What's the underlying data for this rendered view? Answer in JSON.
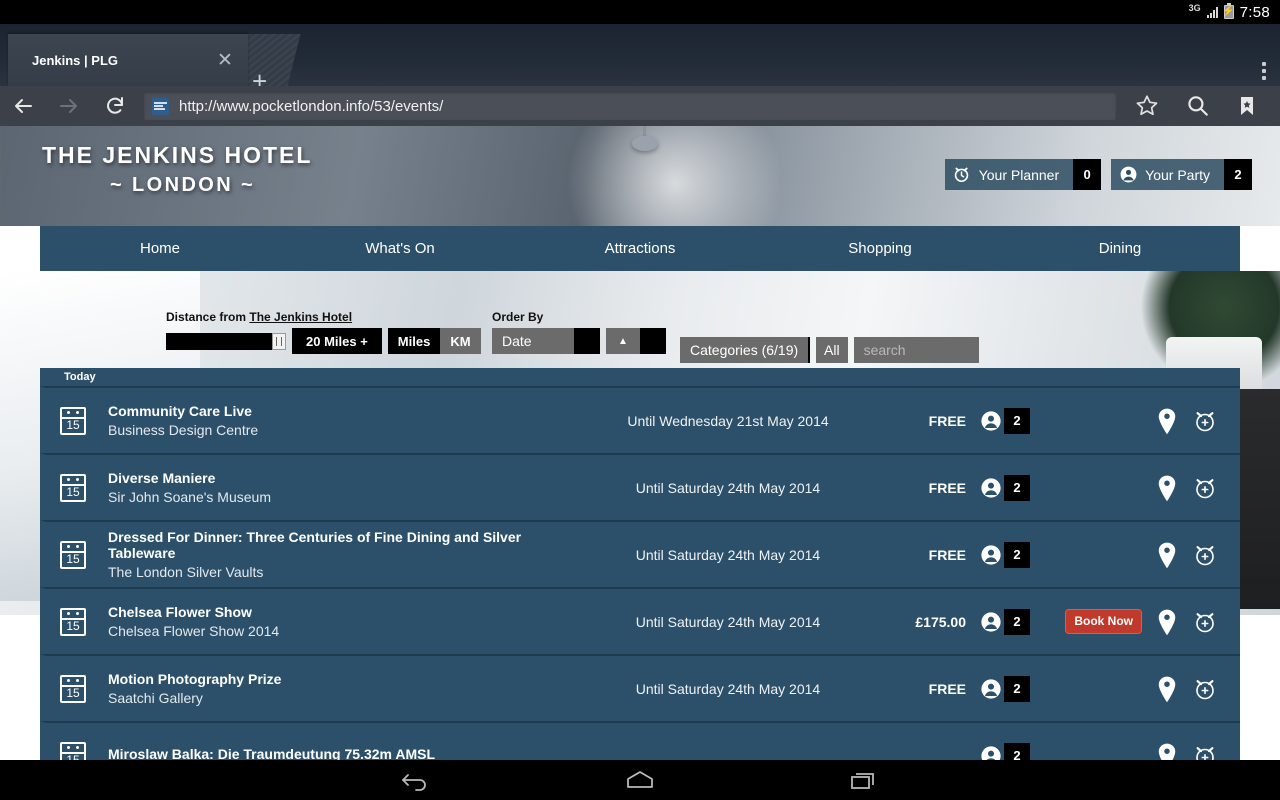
{
  "status_bar": {
    "network": "3G",
    "time": "7:58"
  },
  "browser": {
    "tab": {
      "title": "Jenkins | PLG",
      "close_label": "✕"
    },
    "new_tab_label": "+",
    "url": "http://www.pocketlondon.info/53/events/",
    "icons": {
      "back": "back-arrow-icon",
      "forward": "forward-arrow-icon",
      "reload": "reload-icon",
      "favicon": "site-favicon",
      "bookmark_star": "star-icon",
      "search": "search-icon",
      "bookmarks": "bookmarks-icon",
      "menu": "overflow-menu-icon"
    }
  },
  "site": {
    "hotel_name": "THE JENKINS HOTEL",
    "hotel_location": "~ LONDON ~",
    "pills": [
      {
        "label": "Your Planner",
        "count": "0",
        "icon": "alarm-clock-icon"
      },
      {
        "label": "Your Party",
        "count": "2",
        "icon": "person-icon"
      }
    ],
    "nav": [
      "Home",
      "What's On",
      "Attractions",
      "Shopping",
      "Dining"
    ]
  },
  "filters": {
    "view_list_icon": "list-view-icon",
    "view_map_icon": "map-pin-icon",
    "distance_label_prefix": "Distance from ",
    "distance_label_target": "The Jenkins Hotel",
    "distance_value": "20 Miles +",
    "units": {
      "miles": "Miles",
      "km": "KM",
      "selected": "Miles"
    },
    "order_by_label": "Order By",
    "order_by_value": "Date",
    "sort_direction": "▲",
    "categories_value": "Categories (6/19)",
    "all_label": "All",
    "search_placeholder": "search",
    "search_value": ""
  },
  "events": {
    "group_header": "Today",
    "rows": [
      {
        "day": "15",
        "title": "Community Care Live",
        "venue": "Business Design Centre",
        "date": "Until Wednesday 21st May 2014",
        "price": "FREE",
        "party_count": "2",
        "book_now": null
      },
      {
        "day": "15",
        "title": "Diverse Maniere",
        "venue": "Sir John Soane's Museum",
        "date": "Until Saturday 24th May 2014",
        "price": "FREE",
        "party_count": "2",
        "book_now": null
      },
      {
        "day": "15",
        "title": "Dressed For Dinner: Three Centuries of Fine Dining and Silver Tableware",
        "venue": "The London Silver Vaults",
        "date": "Until Saturday 24th May 2014",
        "price": "FREE",
        "party_count": "2",
        "book_now": null
      },
      {
        "day": "15",
        "title": "Chelsea Flower Show",
        "venue": "Chelsea Flower Show 2014",
        "date": "Until Saturday 24th May 2014",
        "price": "£175.00",
        "party_count": "2",
        "book_now": "Book Now"
      },
      {
        "day": "15",
        "title": "Motion Photography Prize",
        "venue": "Saatchi Gallery",
        "date": "Until Saturday 24th May 2014",
        "price": "FREE",
        "party_count": "2",
        "book_now": null
      },
      {
        "day": "15",
        "title": "Miroslaw Balka: Die Traumdeutung 75.32m AMSL",
        "venue": "",
        "date": "",
        "price": "",
        "party_count": "2",
        "book_now": null
      }
    ],
    "row_icons": {
      "location": "map-pin-icon",
      "add_to_planner": "alarm-clock-plus-icon",
      "party": "person-icon"
    }
  },
  "android_nav": {
    "back": "back-icon",
    "home": "home-icon",
    "recents": "recent-apps-icon"
  },
  "colors": {
    "brand": "#2c5069",
    "accent_red": "#c0392b",
    "chrome": "#3b4049"
  }
}
